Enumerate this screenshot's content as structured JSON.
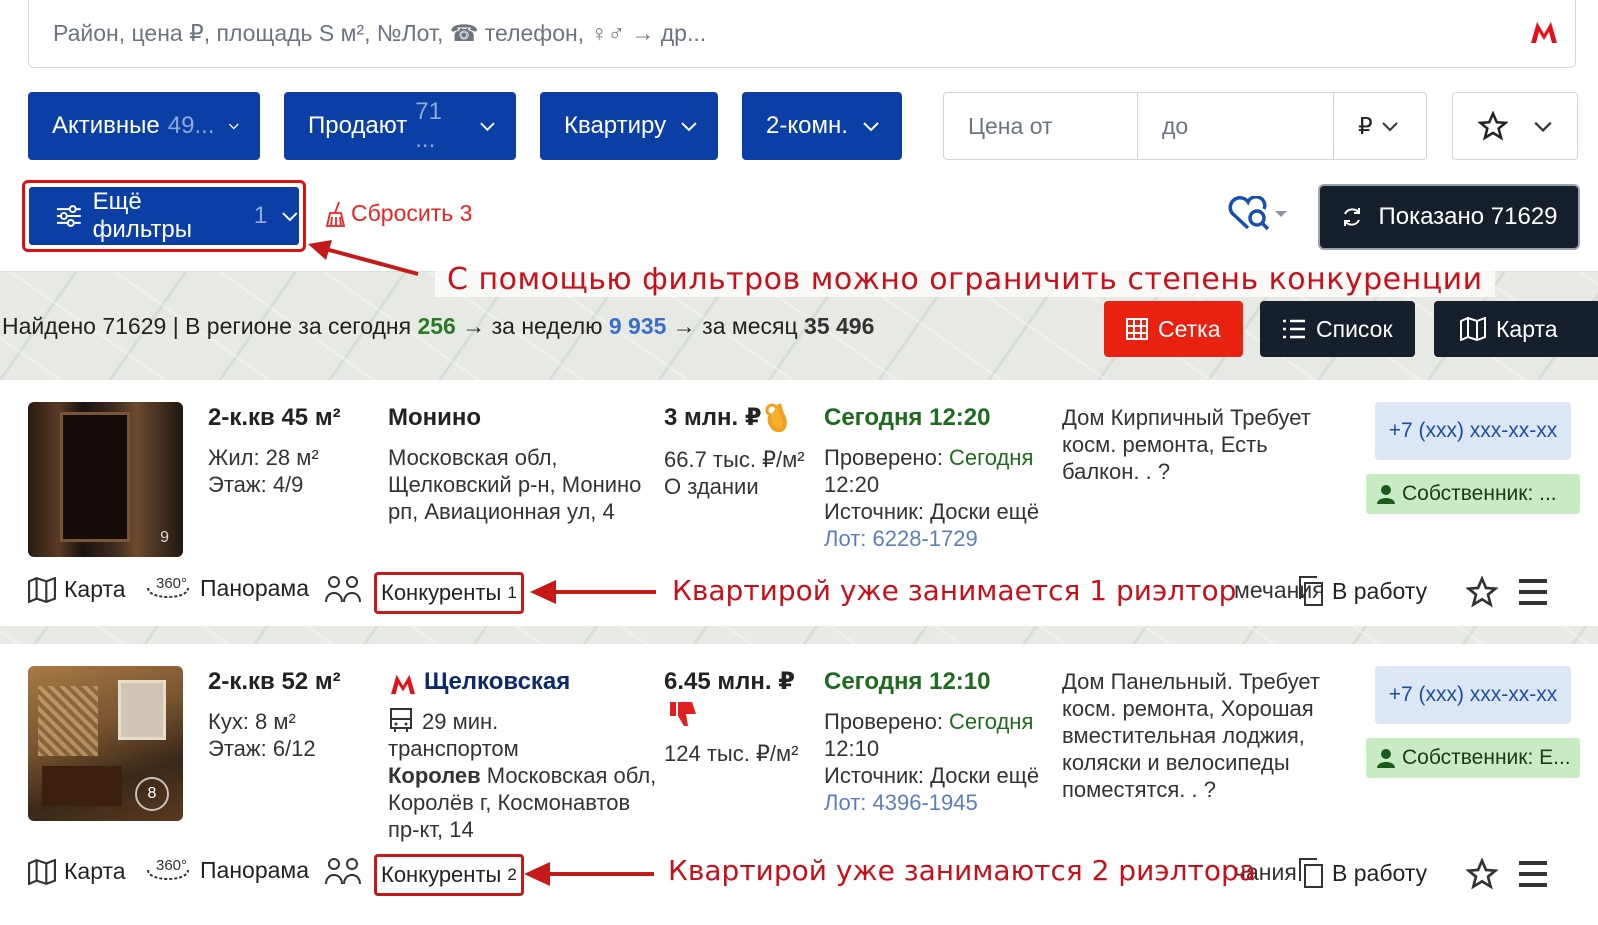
{
  "search": {
    "placeholder": "Район, цена ₽, площадь S м², №Лот, ☎ телефон, ♀♂ → др..."
  },
  "filters": {
    "status": {
      "label": "Активные",
      "count": "49..."
    },
    "deal": {
      "label": "Продают",
      "count": "71 ..."
    },
    "type": {
      "label": "Квартиру"
    },
    "rooms": {
      "label": "2-комн."
    },
    "price_from": "Цена от",
    "price_to": "до",
    "currency": "₽",
    "more": {
      "label": "Ещё фильтры",
      "count": "1"
    },
    "reset": "Сбросить 3",
    "shown": "Показано 71629"
  },
  "annotations": {
    "filters": "С помощью фильтров можно ограничить степень конкуренции",
    "comp1": "Квартирой уже занимается 1 риэлтор",
    "comp2": "Квартирой уже занимаются 2 риэлтора"
  },
  "stats": {
    "found": "Найдено 71629",
    "sep": " | В регионе за сегодня ",
    "today": "256",
    "week_label": " → за неделю ",
    "week": "9 935",
    "month_label": " → за месяц ",
    "month": "35 496"
  },
  "views": {
    "grid": "Сетка",
    "list": "Список",
    "map": "Карта"
  },
  "listings": [
    {
      "photos": "9",
      "title": "2-к.кв 45 м²",
      "detail1": "Жил: 28 м²",
      "detail2": "Этаж: 4/9",
      "place": "Монино",
      "address": [
        "Московская обл,",
        "Щелковский р-н, Монино",
        "рп, Авиационная ул, 4"
      ],
      "price": "3 млн. ₽",
      "ppm": "66.7 тыс. ₽/м²",
      "about": "О здании",
      "date": "Сегодня 12:20",
      "checked_label": "Проверено: ",
      "checked": "Сегодня",
      "checked_time": "12:20",
      "source": "Источник: Доски ещё",
      "lot": "Лот: 6228-1729",
      "desc": [
        "Дом Кирпичный Требует",
        "косм. ремонта, Есть",
        "балкон. . ?"
      ],
      "phone": "+7 (xxx) xxx-xx-xx",
      "owner": "Собственник: ...",
      "actions": {
        "map": "Карта",
        "panorama": "Панорама",
        "competitors": "Конкуренты",
        "comp_count": "1",
        "notes": "мечания",
        "work": "В работу"
      }
    },
    {
      "photos": "8",
      "title": "2-к.кв 52 м²",
      "detail1": "Кух: 8 м²",
      "detail2": "Этаж: 6/12",
      "place": "Щелковская",
      "transit": "29 мин.",
      "transit2": "транспортом",
      "city": "Королев",
      "address": [
        " Московская обл,",
        "Королёв г, Космонавтов",
        "пр-кт, 14"
      ],
      "price": "6.45 млн. ₽",
      "ppm": "124 тыс. ₽/м²",
      "date": "Сегодня 12:10",
      "checked_label": "Проверено: ",
      "checked": "Сегодня",
      "checked_time": "12:10",
      "source": "Источник: Доски ещё",
      "lot": "Лот: 4396-1945",
      "desc": [
        "Дом Панельный. Требует",
        "косм. ремонта, Хорошая",
        "вместительная лоджия,",
        "коляски и велосипеды",
        "поместятся. . ?"
      ],
      "phone": "+7 (xxx) xxx-xx-xx",
      "owner": "Собственник: Е...",
      "actions": {
        "map": "Карта",
        "panorama": "Панорама",
        "competitors": "Конкуренты",
        "comp_count": "2",
        "notes": "чания",
        "work": "В работу"
      }
    }
  ]
}
